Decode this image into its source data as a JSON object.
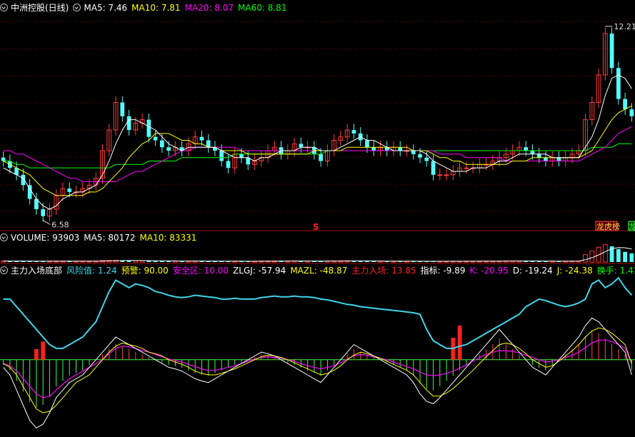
{
  "colors": {
    "up": "#ff3a3a",
    "down": "#54fcfc",
    "ma5": "#ffffff",
    "ma10": "#ffff00",
    "ma20": "#ff00ff",
    "ma60": "#00ff00",
    "grid": "#7a0000",
    "risk": "#3fd5ea",
    "zlgj": "#ffffff",
    "mazl": "#ffff00",
    "entry": "#ff2020",
    "signal": "#ffffaa",
    "k": "#ff00ff"
  },
  "price_panel": {
    "stock_name": "中洲控股(日线)",
    "ma5": "MA5: 7.46",
    "ma10": "MA10: 7.81",
    "ma20": "MA20: 8.07",
    "ma60": "MA60: 8.81",
    "high_label": "12.21",
    "low_label": "6.58",
    "mark_s": "S",
    "badge_a": "龙虎榜",
    "badge_b": "龙"
  },
  "volume_panel": {
    "volume": "VOLUME: 93903",
    "ma5": "MA5: 80172",
    "ma10": "MA10: 83331"
  },
  "indicator_panel": {
    "name": "主力入场底部",
    "risk": "风险值: 1.24",
    "warning": "预警: 90.00",
    "safe": "安全区: 10.00",
    "zlgj": "ZLGJ: -57.94",
    "mazl": "MAZL: -48.87",
    "entry": "主力入场: 13.85",
    "index": "指标: -9.89",
    "k": "K: -20.95",
    "d": "D: -19.24",
    "j": "J: -24.38",
    "turnover": "换手: 1.41"
  },
  "chart_data": {
    "type": "candlestick",
    "panels": [
      "price",
      "volume",
      "indicator"
    ],
    "price": {
      "ylim": [
        6.3,
        12.6
      ],
      "high": 12.21,
      "low": 6.58,
      "close": [
        8.3,
        8.1,
        7.9,
        7.6,
        7.2,
        6.9,
        6.7,
        6.9,
        7.3,
        7.5,
        7.4,
        7.4,
        7.5,
        7.6,
        7.8,
        8.6,
        9.2,
        10.0,
        9.6,
        9.2,
        9.4,
        9.5,
        9.0,
        8.9,
        8.7,
        8.6,
        8.7,
        8.6,
        8.8,
        9.0,
        8.9,
        8.7,
        8.6,
        8.3,
        8.1,
        8.5,
        8.4,
        8.2,
        8.3,
        8.4,
        8.6,
        8.7,
        8.5,
        8.6,
        8.8,
        8.7,
        8.7,
        8.5,
        8.3,
        8.6,
        8.9,
        9.0,
        9.2,
        9.1,
        8.9,
        8.7,
        8.6,
        8.7,
        8.6,
        8.7,
        8.6,
        8.6,
        8.5,
        8.4,
        8.3,
        7.9,
        7.9,
        7.9,
        8.0,
        8.1,
        8.1,
        8.1,
        8.2,
        8.2,
        8.3,
        8.4,
        8.5,
        8.6,
        8.7,
        8.6,
        8.5,
        8.4,
        8.3,
        8.4,
        8.3,
        8.4,
        8.5,
        8.6,
        9.5,
        10.0,
        10.8,
        12.0,
        11.0,
        10.1,
        9.8,
        9.6
      ],
      "ma5": [
        8.1,
        8.0,
        7.9,
        7.8,
        7.5,
        7.2,
        7.0,
        6.9,
        7.0,
        7.2,
        7.3,
        7.4,
        7.4,
        7.5,
        7.6,
        7.9,
        8.3,
        8.8,
        9.2,
        9.5,
        9.5,
        9.4,
        9.3,
        9.2,
        9.0,
        8.8,
        8.7,
        8.6,
        8.7,
        8.7,
        8.7,
        8.7,
        8.7,
        8.6,
        8.5,
        8.4,
        8.4,
        8.4,
        8.3,
        8.4,
        8.4,
        8.5,
        8.6,
        8.6,
        8.6,
        8.7,
        8.7,
        8.7,
        8.6,
        8.6,
        8.6,
        8.7,
        8.8,
        8.9,
        9.0,
        8.9,
        8.9,
        8.8,
        8.7,
        8.6,
        8.6,
        8.6,
        8.6,
        8.6,
        8.5,
        8.3,
        8.2,
        8.1,
        8.0,
        8.0,
        8.0,
        8.1,
        8.1,
        8.1,
        8.2,
        8.3,
        8.3,
        8.4,
        8.5,
        8.5,
        8.5,
        8.5,
        8.5,
        8.4,
        8.4,
        8.4,
        8.4,
        8.4,
        8.7,
        9.0,
        9.5,
        10.2,
        10.7,
        10.8,
        10.7,
        10.4
      ],
      "ma10": [
        8.3,
        8.2,
        8.1,
        8.0,
        7.9,
        7.7,
        7.5,
        7.4,
        7.3,
        7.3,
        7.3,
        7.3,
        7.3,
        7.4,
        7.4,
        7.5,
        7.7,
        7.9,
        8.1,
        8.4,
        8.6,
        8.8,
        8.9,
        9.1,
        9.1,
        9.1,
        9.0,
        8.9,
        8.9,
        8.8,
        8.8,
        8.7,
        8.7,
        8.6,
        8.6,
        8.6,
        8.6,
        8.5,
        8.5,
        8.5,
        8.5,
        8.5,
        8.5,
        8.5,
        8.5,
        8.5,
        8.5,
        8.6,
        8.6,
        8.6,
        8.6,
        8.6,
        8.7,
        8.7,
        8.7,
        8.7,
        8.7,
        8.7,
        8.7,
        8.7,
        8.7,
        8.7,
        8.6,
        8.6,
        8.6,
        8.5,
        8.4,
        8.4,
        8.3,
        8.3,
        8.2,
        8.2,
        8.2,
        8.2,
        8.2,
        8.2,
        8.2,
        8.3,
        8.3,
        8.3,
        8.4,
        8.4,
        8.4,
        8.4,
        8.4,
        8.4,
        8.4,
        8.4,
        8.5,
        8.6,
        8.9,
        9.2,
        9.5,
        9.7,
        9.8,
        9.9
      ],
      "ma20": [
        8.6,
        8.6,
        8.5,
        8.5,
        8.4,
        8.3,
        8.2,
        8.1,
        8.0,
        7.9,
        7.8,
        7.8,
        7.7,
        7.7,
        7.7,
        7.7,
        7.7,
        7.7,
        7.8,
        7.9,
        8.0,
        8.0,
        8.1,
        8.2,
        8.3,
        8.4,
        8.5,
        8.6,
        8.6,
        8.7,
        8.7,
        8.7,
        8.7,
        8.7,
        8.7,
        8.7,
        8.6,
        8.6,
        8.6,
        8.6,
        8.6,
        8.6,
        8.6,
        8.6,
        8.6,
        8.6,
        8.6,
        8.6,
        8.6,
        8.6,
        8.6,
        8.6,
        8.6,
        8.6,
        8.6,
        8.6,
        8.6,
        8.6,
        8.6,
        8.6,
        8.6,
        8.6,
        8.6,
        8.6,
        8.6,
        8.6,
        8.5,
        8.5,
        8.5,
        8.5,
        8.4,
        8.4,
        8.4,
        8.4,
        8.4,
        8.4,
        8.3,
        8.3,
        8.3,
        8.3,
        8.3,
        8.3,
        8.3,
        8.3,
        8.3,
        8.3,
        8.3,
        8.3,
        8.4,
        8.5,
        8.6,
        8.7,
        8.9,
        9.1,
        9.2,
        9.3
      ],
      "ma60": [
        8.3,
        8.3,
        8.2,
        8.2,
        8.1,
        8.1,
        8.1,
        8.1,
        8.1,
        8.1,
        8.1,
        8.1,
        8.1,
        8.1,
        8.1,
        8.1,
        8.1,
        8.2,
        8.2,
        8.2,
        8.2,
        8.2,
        8.3,
        8.3,
        8.3,
        8.3,
        8.3,
        8.4,
        8.4,
        8.4,
        8.4,
        8.4,
        8.4,
        8.4,
        8.4,
        8.5,
        8.5,
        8.5,
        8.5,
        8.5,
        8.5,
        8.5,
        8.5,
        8.5,
        8.5,
        8.5,
        8.5,
        8.5,
        8.5,
        8.6,
        8.6,
        8.6,
        8.6,
        8.6,
        8.6,
        8.6,
        8.6,
        8.6,
        8.6,
        8.6,
        8.6,
        8.6,
        8.6,
        8.6,
        8.6,
        8.6,
        8.6,
        8.6,
        8.6,
        8.6,
        8.6,
        8.6,
        8.6,
        8.6,
        8.6,
        8.6,
        8.6,
        8.6,
        8.6,
        8.6,
        8.6,
        8.6,
        8.6,
        8.6,
        8.6,
        8.6,
        8.6,
        8.6,
        8.6,
        8.7,
        8.7,
        8.7,
        8.7,
        8.8,
        8.8,
        8.8
      ]
    },
    "volume": {
      "max": 200000,
      "values": [
        12000,
        10000,
        11000,
        10000,
        9000,
        8000,
        9000,
        10000,
        12000,
        11000,
        10000,
        9000,
        9000,
        10000,
        11000,
        16000,
        18000,
        20000,
        17000,
        15000,
        16000,
        15000,
        13000,
        12000,
        11000,
        10000,
        11000,
        10000,
        11000,
        12000,
        11000,
        10000,
        9000,
        9000,
        8000,
        10000,
        9000,
        8000,
        9000,
        10000,
        11000,
        12000,
        10000,
        11000,
        12000,
        11000,
        11000,
        10000,
        9000,
        11000,
        12000,
        13000,
        14000,
        12000,
        11000,
        10000,
        9000,
        10000,
        9000,
        10000,
        9000,
        9000,
        9000,
        8000,
        8000,
        9000,
        8000,
        8000,
        9000,
        9000,
        9000,
        9000,
        10000,
        10000,
        11000,
        11000,
        12000,
        12000,
        12000,
        11000,
        11000,
        10000,
        10000,
        10000,
        10000,
        10000,
        11000,
        12000,
        80000,
        120000,
        160000,
        190000,
        170000,
        140000,
        110000,
        93903
      ]
    },
    "indicator": {
      "ylim": [
        -100,
        110
      ],
      "risk_values": [
        80,
        80,
        70,
        60,
        50,
        40,
        30,
        20,
        15,
        15,
        20,
        25,
        30,
        40,
        50,
        70,
        90,
        105,
        100,
        95,
        100,
        98,
        95,
        90,
        88,
        85,
        83,
        82,
        83,
        85,
        84,
        83,
        82,
        80,
        80,
        81,
        80,
        80,
        80,
        82,
        83,
        84,
        83,
        83,
        84,
        83,
        83,
        82,
        80,
        79,
        77,
        75,
        73,
        72,
        70,
        69,
        68,
        67,
        66,
        65,
        64,
        63,
        62,
        60,
        40,
        25,
        20,
        15,
        15,
        18,
        20,
        25,
        30,
        35,
        40,
        45,
        50,
        55,
        60,
        70,
        75,
        80,
        78,
        75,
        72,
        70,
        72,
        75,
        80,
        100,
        105,
        95,
        100,
        108,
        95,
        85
      ],
      "zlgj_values": [
        -10,
        -20,
        -40,
        -60,
        -80,
        -90,
        -85,
        -70,
        -50,
        -40,
        -30,
        -25,
        -20,
        -10,
        0,
        10,
        20,
        30,
        25,
        20,
        15,
        10,
        5,
        0,
        -5,
        -10,
        -12,
        -15,
        -20,
        -25,
        -28,
        -30,
        -25,
        -20,
        -15,
        -10,
        -5,
        0,
        5,
        10,
        8,
        5,
        0,
        -5,
        -10,
        -15,
        -20,
        -25,
        -30,
        -20,
        -10,
        0,
        10,
        20,
        15,
        10,
        5,
        0,
        -5,
        -10,
        -15,
        -20,
        -30,
        -45,
        -55,
        -58,
        -50,
        -40,
        -30,
        -20,
        -10,
        0,
        10,
        20,
        30,
        40,
        30,
        20,
        10,
        0,
        -10,
        -15,
        -20,
        -10,
        0,
        10,
        20,
        30,
        45,
        55,
        50,
        40,
        30,
        20,
        10,
        -20
      ],
      "mazl_values": [
        -5,
        -10,
        -20,
        -35,
        -50,
        -65,
        -70,
        -68,
        -60,
        -50,
        -40,
        -30,
        -25,
        -20,
        -10,
        0,
        10,
        18,
        22,
        20,
        18,
        15,
        10,
        8,
        5,
        0,
        -3,
        -6,
        -10,
        -15,
        -18,
        -20,
        -20,
        -18,
        -15,
        -12,
        -8,
        -4,
        0,
        4,
        6,
        5,
        3,
        0,
        -4,
        -8,
        -12,
        -16,
        -20,
        -18,
        -14,
        -8,
        0,
        6,
        10,
        8,
        5,
        2,
        -2,
        -6,
        -10,
        -14,
        -20,
        -30,
        -40,
        -48,
        -48,
        -44,
        -38,
        -30,
        -22,
        -14,
        -5,
        4,
        12,
        20,
        22,
        20,
        15,
        8,
        0,
        -5,
        -10,
        -8,
        -2,
        5,
        12,
        20,
        30,
        38,
        42,
        40,
        35,
        28,
        20,
        -5
      ],
      "k_values": [
        -5,
        -8,
        -15,
        -25,
        -35,
        -45,
        -50,
        -48,
        -40,
        -32,
        -25,
        -20,
        -15,
        -10,
        -5,
        0,
        8,
        15,
        18,
        17,
        15,
        12,
        10,
        7,
        4,
        1,
        -1,
        -3,
        -6,
        -9,
        -12,
        -14,
        -14,
        -12,
        -10,
        -8,
        -5,
        -2,
        1,
        3,
        4,
        3,
        2,
        0,
        -2,
        -5,
        -8,
        -10,
        -12,
        -10,
        -8,
        -4,
        1,
        5,
        7,
        6,
        4,
        2,
        0,
        -3,
        -6,
        -9,
        -12,
        -16,
        -20,
        -21,
        -20,
        -18,
        -15,
        -11,
        -7,
        -2,
        3,
        7,
        10,
        12,
        12,
        11,
        9,
        6,
        3,
        0,
        -3,
        -2,
        0,
        3,
        6,
        10,
        16,
        22,
        26,
        26,
        24,
        20,
        15,
        -5
      ],
      "entry_bars": [
        {
          "index": 5,
          "value": 14
        },
        {
          "index": 6,
          "value": 24
        },
        {
          "index": 68,
          "value": 29
        },
        {
          "index": 69,
          "value": 45
        }
      ]
    }
  }
}
